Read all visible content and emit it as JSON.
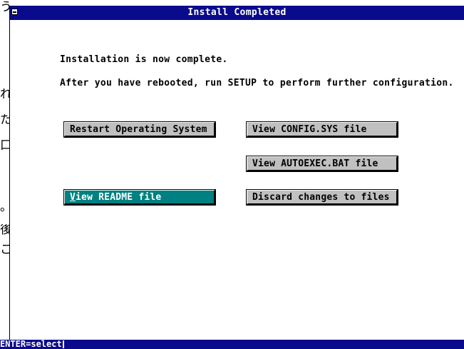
{
  "background_fragments": [
    "う",
    "れ",
    "た",
    "口",
    "。",
    "後",
    "こ"
  ],
  "window": {
    "title": "Install Completed",
    "message_line1": "Installation is now complete.",
    "message_line2": "After you have rebooted, run SETUP to perform further configuration."
  },
  "buttons": {
    "restart": "Restart Operating System",
    "view_config": "View CONFIG.SYS file",
    "view_autoexec": "View AUTOEXEC.BAT file",
    "view_readme_first": "V",
    "view_readme_rest": "iew README file",
    "discard": "Discard changes to files"
  },
  "statusbar": {
    "text": "ENTER=select"
  },
  "colors": {
    "title_bar": "#0a0a8c",
    "selected_button": "#008080",
    "button_face": "#c0c0c0"
  }
}
